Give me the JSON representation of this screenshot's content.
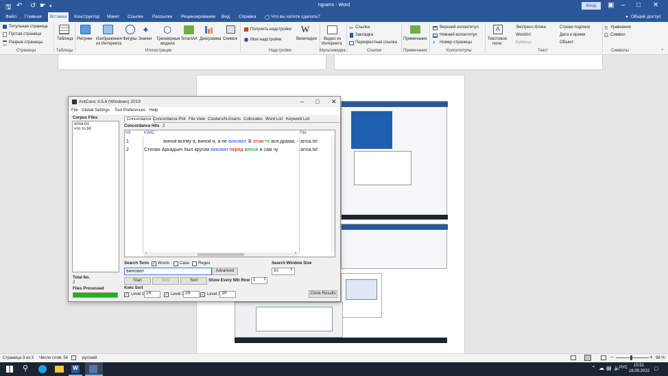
{
  "word": {
    "title": "ngrams - Word",
    "signin": "Вход",
    "tabs": [
      "Файл",
      "Главная",
      "Вставка",
      "Конструктор",
      "Макет",
      "Ссылки",
      "Рассылки",
      "Рецензирование",
      "Вид",
      "Справка"
    ],
    "tell_me": "Что вы хотите сделать?",
    "share": "Общий доступ",
    "ribbon": {
      "pages": [
        "Титульная страница",
        "Пустая страница",
        "Разрыв страницы"
      ],
      "table": "Таблица",
      "pictures": "Рисунки",
      "online_pictures": [
        "Изображения",
        "из Интернета"
      ],
      "shapes": "Фигуры",
      "icons": "Значки",
      "models": [
        "Трехмерные",
        "модели"
      ],
      "smartart": "SmartArt",
      "chart": "Диаграмма",
      "screenshot": "Снимок",
      "get_addins": "Получить надстройки",
      "my_addins": "Мои надстройки",
      "wikipedia": "Википедия",
      "video": [
        "Видео из",
        "Интернета"
      ],
      "link": "Ссылка",
      "bookmark": "Закладка",
      "crossref": "Перекрестная ссылка",
      "comment": "Примечание",
      "header": "Верхний колонтитул",
      "footer": "Нижний колонтитул",
      "pagenum": "Номер страницы",
      "textbox": [
        "Текстовое",
        "поле"
      ],
      "quickparts": "Экспресс-блоки",
      "wordart": "WordArt",
      "dropcap": "Буквица",
      "sigline": "Строки подписи",
      "datetime": "Дата и время",
      "object": "Объект",
      "equation": "Уравнение",
      "symbol": "Символ"
    },
    "groups": [
      "Страницы",
      "Таблицы",
      "Иллюстрации",
      "Надстройки",
      "Мультимедиа",
      "Ссылки",
      "Примечания",
      "Колонтитулы",
      "Текст",
      "Символы"
    ],
    "status": {
      "page": "Страница 3 из 3",
      "words": "Число слов: 54",
      "lang": "русский",
      "zoom": "98 %"
    }
  },
  "antconc": {
    "title": "AntConc 3.5.8 (Windows) 2019",
    "menu": [
      "File",
      "Global Settings",
      "Tool Preferences",
      "Help"
    ],
    "corpus_files_label": "Corpus Files",
    "files": [
      "anna.txt",
      "что то.txt"
    ],
    "total_no_label": "Total No.",
    "total_no": "2",
    "files_processed_label": "Files Processed",
    "tabs": [
      "Concordance",
      "Concordance Plot",
      "File View",
      "Clusters/N-Grams",
      "Collocates",
      "Word List",
      "Keyword List"
    ],
    "hits_label": "Concordance Hits",
    "hits_count": "2",
    "col_hit": "Hit",
    "col_kwic": "KWIC",
    "col_file": "File",
    "rows": [
      {
        "hit": "1",
        "left": "виной всему я, виной я, а не ",
        "kw": "виноват",
        "mid": ". В ",
        "c1": "этом",
        "dash": "-",
        "c2": "то",
        "right": " вся драма, -",
        "file": "anna.txt"
      },
      {
        "hit": "2",
        "left": "Степан Аркадьич был кругом ",
        "kw": "виноват",
        "mid": " ",
        "c1": "перед",
        "dash": " ",
        "c2": "женой",
        "right": " и сам чу",
        "file": "anna.txt"
      }
    ],
    "search_term_label": "Search Term",
    "words_label": "Words",
    "case_label": "Case",
    "regex_label": "Regex",
    "search_value": "виноват",
    "advanced": "Advanced",
    "window_size_label": "Search Window Size",
    "window_size": "50",
    "start": "Start",
    "stop": "Stop",
    "sort": "Sort",
    "nth_row_label": "Show Every Nth Row",
    "nth_row": "1",
    "kwic_sort_label": "Kwic Sort",
    "level1_label": "Level 1",
    "level1": "1R",
    "level2_label": "Level 2",
    "level2": "2R",
    "level3_label": "Level 3",
    "level3": "3R",
    "clone": "Clone Results"
  },
  "taskbar": {
    "lang": "РУС",
    "time": "15:51",
    "date": "16.09.2022"
  },
  "colors": {
    "word_blue": "#2b579a",
    "kwic_blue": "#1f4fff",
    "red": "#d40000",
    "green": "#00a000",
    "progress": "#1db31d"
  }
}
